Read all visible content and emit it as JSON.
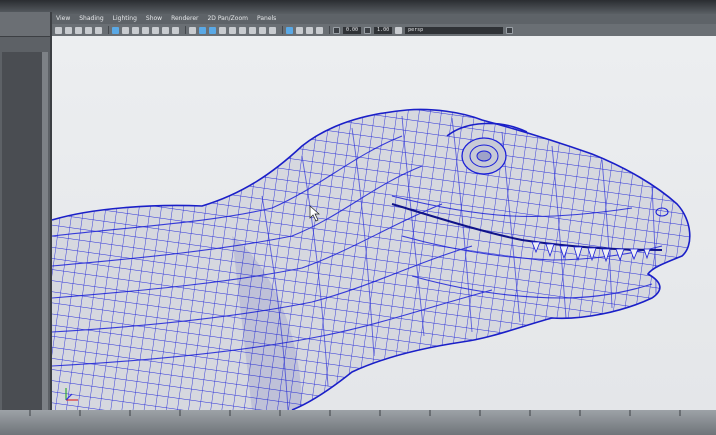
{
  "viewport": {
    "menu": [
      "View",
      "Shading",
      "Lighting",
      "Show",
      "Renderer",
      "2D Pan/Zoom",
      "Panels"
    ],
    "toolbar": {
      "near_value": "0.00",
      "far_value": "1.00",
      "camera": "persp"
    },
    "model_icon": "trex-wireframe-icon",
    "axis_icon": "view-axis-icon",
    "colors": {
      "wire": "#1b20d8",
      "surface": "#d4d6dd",
      "background": "#eaecee"
    }
  }
}
